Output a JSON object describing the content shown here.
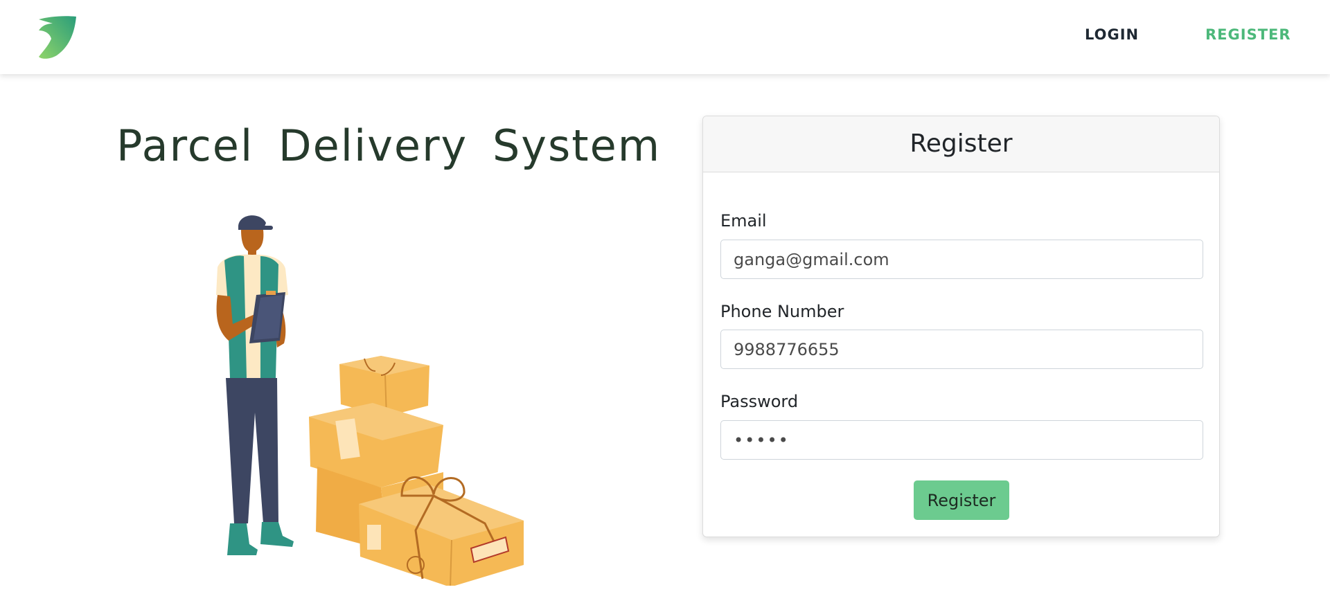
{
  "nav": {
    "logo_icon": "leaf-logo-icon",
    "login_label": "LOGIN",
    "register_label": "REGISTER"
  },
  "hero": {
    "title": "Parcel Delivery System",
    "illustration_icon": "delivery-man-with-parcels-illustration"
  },
  "form": {
    "title": "Register",
    "email_label": "Email",
    "email_value": "ganga@gmail.com",
    "phone_label": "Phone Number",
    "phone_value": "9988776655",
    "password_label": "Password",
    "password_value": "•••••",
    "submit_label": "Register"
  },
  "colors": {
    "accent_green": "#4cb87a",
    "button_green": "#6ccb8f",
    "title_dark": "#263a2c"
  }
}
